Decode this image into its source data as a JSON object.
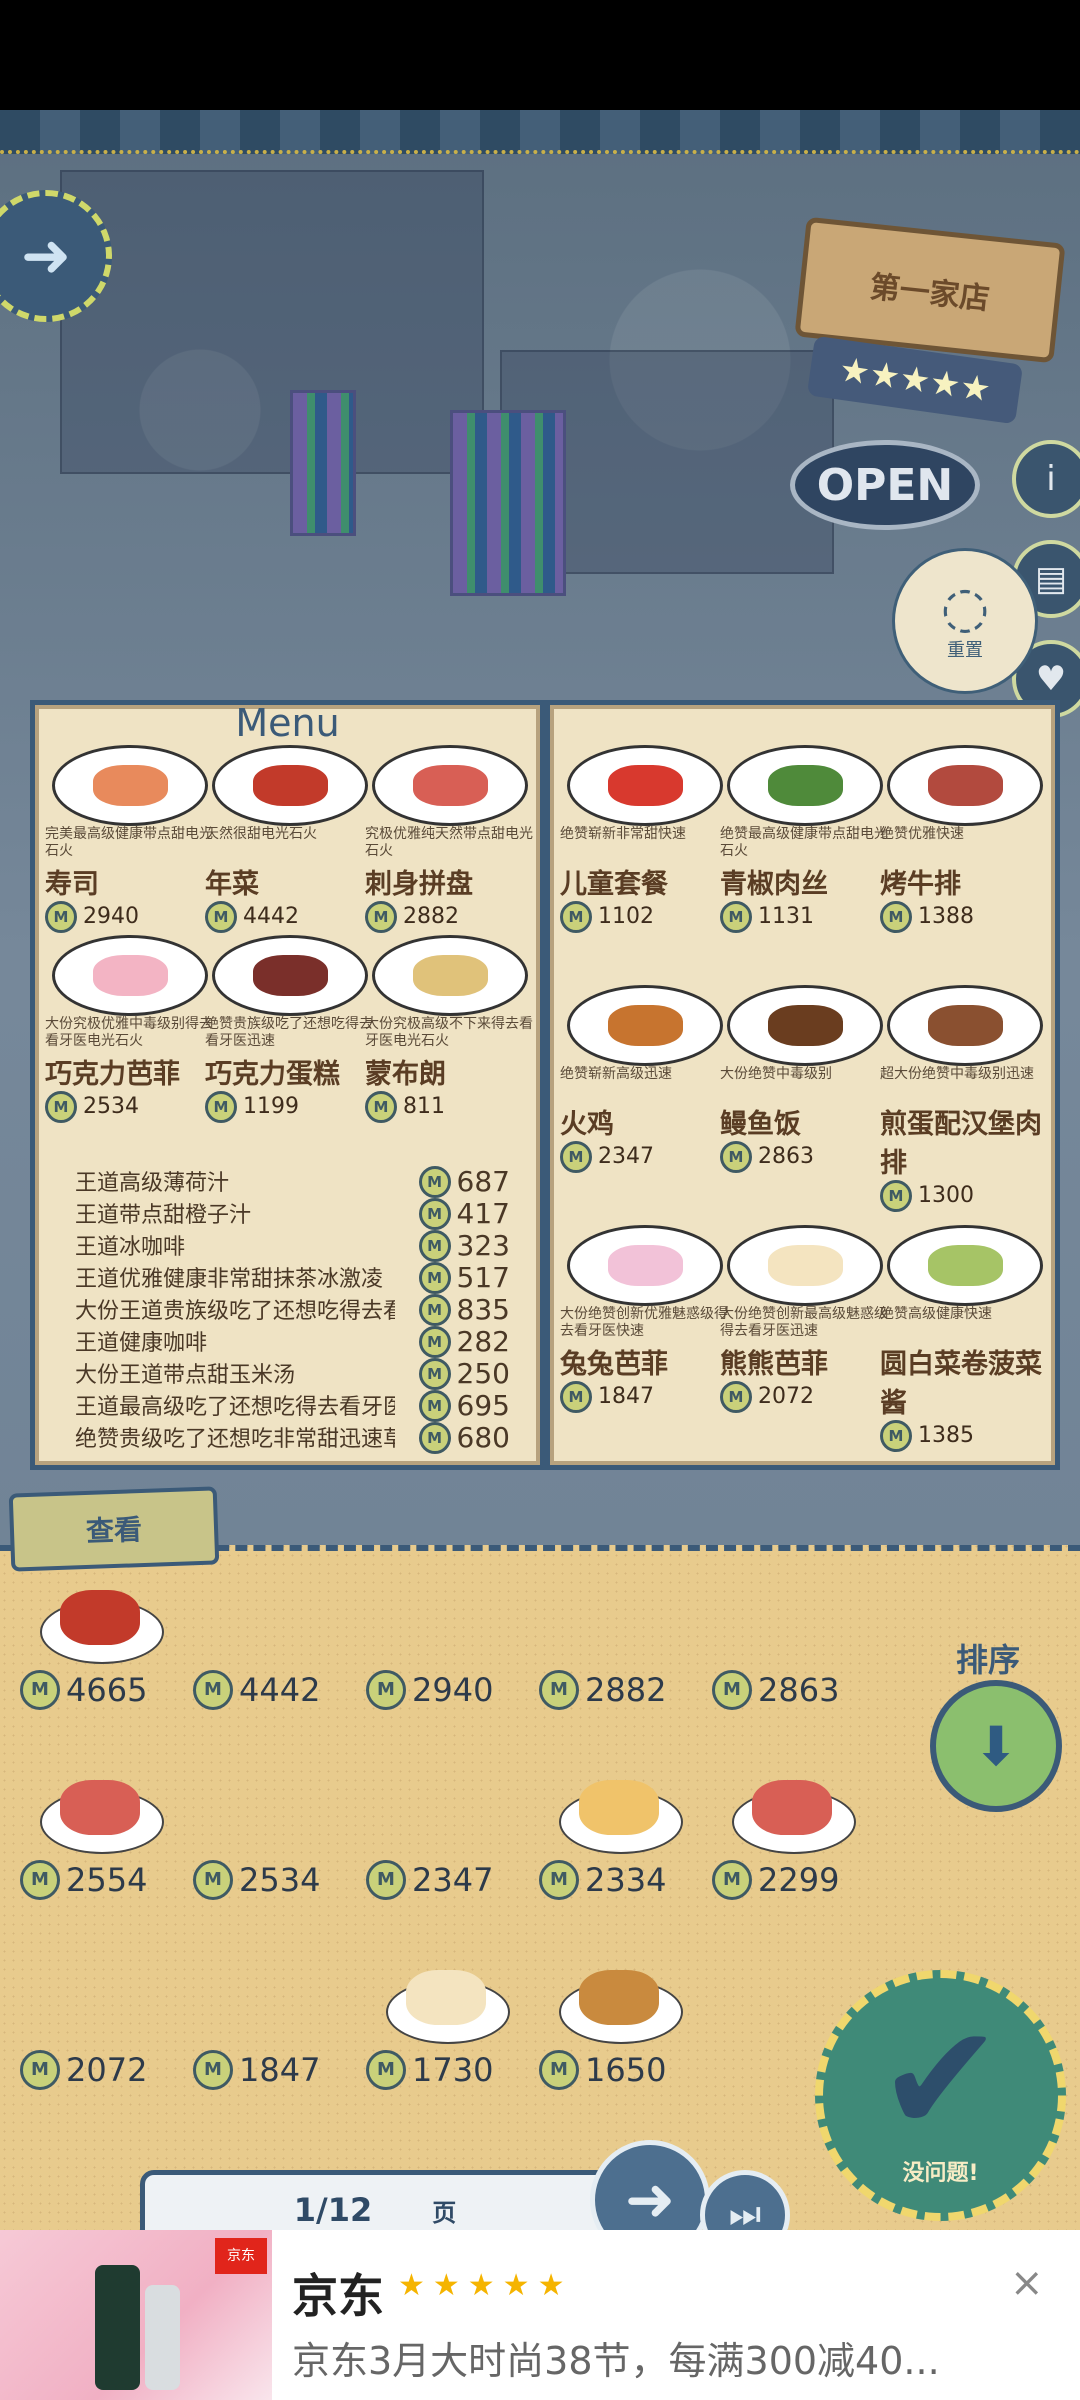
{
  "hud": {
    "shop_sign": "第一家店",
    "rating_stars": "★★★★★",
    "open_sign": "OPEN",
    "reset_label": "重置",
    "info_icon": "i"
  },
  "menu": {
    "title": "Menu",
    "left_items": [
      {
        "desc": "完美最高级健康带点甜电光石火",
        "name": "寿司",
        "price": "2940",
        "color": "#e88a5c"
      },
      {
        "desc": "天然很甜电光石火",
        "name": "年菜",
        "price": "4442",
        "color": "#c23a2a"
      },
      {
        "desc": "究极优雅纯天然带点甜电光石火",
        "name": "刺身拼盘",
        "price": "2882",
        "color": "#d85f55"
      },
      {
        "desc": "大份究极优雅中毒级别得去看牙医电光石火",
        "name": "巧克力芭菲",
        "price": "2534",
        "color": "#f3b4c4"
      },
      {
        "desc": "绝赞贵族级吃了还想吃得去看牙医迅速",
        "name": "巧克力蛋糕",
        "price": "1199",
        "color": "#7a2f2a"
      },
      {
        "desc": "大份究极高级不下来得去看牙医电光石火",
        "name": "蒙布朗",
        "price": "811",
        "color": "#e0c27a"
      }
    ],
    "drinks": [
      {
        "name": "王道高级薄荷汁",
        "price": "687"
      },
      {
        "name": "王道带点甜橙子汁",
        "price": "417"
      },
      {
        "name": "王道冰咖啡",
        "price": "323"
      },
      {
        "name": "王道优雅健康非常甜抹茶冰激凌",
        "price": "517"
      },
      {
        "name": "大份王道贵族级吃了还想吃得去看牙医迅速黑加仑甜筒",
        "price": "835"
      },
      {
        "name": "王道健康咖啡",
        "price": "282"
      },
      {
        "name": "大份王道带点甜玉米汤",
        "price": "250"
      },
      {
        "name": "王道最高级吃了还想吃得去看牙医",
        "price": "695"
      },
      {
        "name": "绝赞贵级吃了还想吃非常甜迅速草莓奶油蛋糕",
        "price": "680"
      }
    ],
    "right_items": [
      {
        "desc": "绝赞崭新非常甜快速",
        "name": "儿童套餐",
        "price": "1102",
        "color": "#d8392e"
      },
      {
        "desc": "绝赞最高级健康带点甜电光石火",
        "name": "青椒肉丝",
        "price": "1131",
        "color": "#4f8a3a"
      },
      {
        "desc": "绝赞优雅快速",
        "name": "烤牛排",
        "price": "1388",
        "color": "#b24a3e"
      },
      {
        "desc": "绝赞崭新高级迅速",
        "name": "火鸡",
        "price": "2347",
        "color": "#c7742f"
      },
      {
        "desc": "大份绝赞中毒级别",
        "name": "鳗鱼饭",
        "price": "2863",
        "color": "#6a3d1f"
      },
      {
        "desc": "超大份绝赞中毒级别迅速",
        "name": "煎蛋配汉堡肉排",
        "price": "1300",
        "color": "#8a5030"
      },
      {
        "desc": "大份绝赞创新优雅魅惑级得去看牙医快速",
        "name": "兔兔芭菲",
        "price": "1847",
        "color": "#f2c2d8"
      },
      {
        "desc": "大份绝赞创新最高级魅惑级得去看牙医迅速",
        "name": "熊熊芭菲",
        "price": "2072",
        "color": "#f4e4c0"
      },
      {
        "desc": "绝赞高级健康快速",
        "name": "圆白菜卷菠菜酱",
        "price": "1385",
        "color": "#a6c466"
      }
    ]
  },
  "tray": {
    "tab_label": "查看",
    "sort_label": "排序",
    "items": [
      {
        "price": "4665",
        "color": "#c23a2a",
        "has_image": true
      },
      {
        "price": "4442",
        "color": "",
        "has_image": false
      },
      {
        "price": "2940",
        "color": "",
        "has_image": false
      },
      {
        "price": "2882",
        "color": "",
        "has_image": false
      },
      {
        "price": "2863",
        "color": "",
        "has_image": false
      },
      {
        "price": "2554",
        "color": "#d85f55",
        "has_image": true
      },
      {
        "price": "2534",
        "color": "",
        "has_image": false
      },
      {
        "price": "2347",
        "color": "",
        "has_image": false
      },
      {
        "price": "2334",
        "color": "#f0c36a",
        "has_image": true
      },
      {
        "price": "2299",
        "color": "#d85f55",
        "has_image": true
      },
      {
        "price": "2072",
        "color": "",
        "has_image": false
      },
      {
        "price": "1847",
        "color": "",
        "has_image": false
      },
      {
        "price": "1730",
        "color": "#f4e4c0",
        "has_image": true
      },
      {
        "price": "1650",
        "color": "#c98a3e",
        "has_image": true
      }
    ],
    "confirm_label": "没问题!",
    "page": "1/12",
    "page_suffix": "页"
  },
  "ad": {
    "logo": "京东",
    "title": "京东",
    "stars": "★★★★★",
    "desc": "京东3月大时尚38节，每满300减40...",
    "close": "×"
  }
}
